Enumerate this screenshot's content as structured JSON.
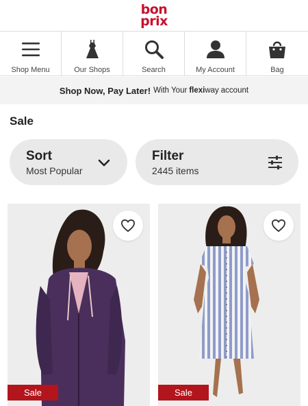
{
  "brand": {
    "logo_top": "bon",
    "logo_bottom": "prix",
    "color": "#c8102e"
  },
  "nav": {
    "items": [
      {
        "label": "Shop Menu",
        "icon": "menu-icon"
      },
      {
        "label": "Our Shops",
        "icon": "dress-icon"
      },
      {
        "label": "Search",
        "icon": "search-icon"
      },
      {
        "label": "My Account",
        "icon": "user-icon"
      },
      {
        "label": "Bag",
        "icon": "bag-icon"
      }
    ]
  },
  "promo": {
    "main": "Shop Now, Pay Later!",
    "pre": "With Your",
    "brand": "flexi",
    "brand_suffix": "way",
    "post": "account"
  },
  "page": {
    "title": "Sale"
  },
  "sort": {
    "title": "Sort",
    "value": "Most Popular",
    "icon": "chevron-down-icon"
  },
  "filter": {
    "title": "Filter",
    "count": "2445 items",
    "icon": "sliders-icon"
  },
  "products": [
    {
      "badge": "Sale",
      "image": "woman in purple zip hoodie"
    },
    {
      "badge": "Sale",
      "image": "woman in blue and white striped dress"
    }
  ],
  "colors": {
    "sale_badge": "#b3151c",
    "pill_bg": "#e9e9e9",
    "promo_bg": "#f3f3f3"
  }
}
